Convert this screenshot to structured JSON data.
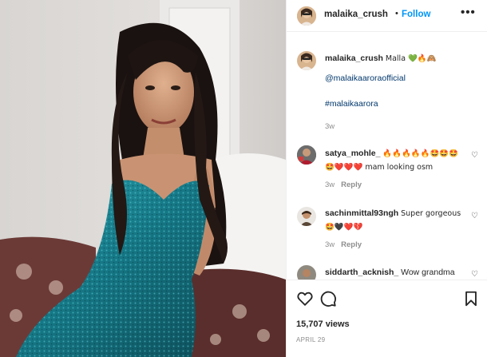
{
  "post": {
    "username": "malaika_crush",
    "separator": "•",
    "follow_label": "Follow",
    "more_label": "•••"
  },
  "caption": {
    "username": "malaika_crush",
    "text": "Malla 💚🔥🙈",
    "mention": "@malaikaaroraofficial",
    "hashtag": "#malaikaarora",
    "age": "3w"
  },
  "comments": [
    {
      "username": "satya_mohle_",
      "text": "🔥🔥🔥🔥🔥🤩🤩🤩 🤩❤️❤️❤️ mam looking osm",
      "age": "3w",
      "reply_label": "Reply"
    },
    {
      "username": "sachinmittal93ngh",
      "text": "Super gorgeous 🤩🖤❤️💔",
      "age": "3w",
      "reply_label": "Reply"
    },
    {
      "username": "siddarth_acknish_",
      "text": "Wow grandma"
    }
  ],
  "footer": {
    "views": "15,707 views",
    "date": "APRIL 29"
  },
  "icons": {
    "like": "heart-outline-icon",
    "comment": "speech-bubble-icon",
    "save": "bookmark-icon",
    "comment_like": "small-heart-icon"
  },
  "colors": {
    "follow": "#0095f6",
    "link": "#00376b",
    "muted": "#8e8e8e",
    "dress": "#1c7f8a"
  }
}
